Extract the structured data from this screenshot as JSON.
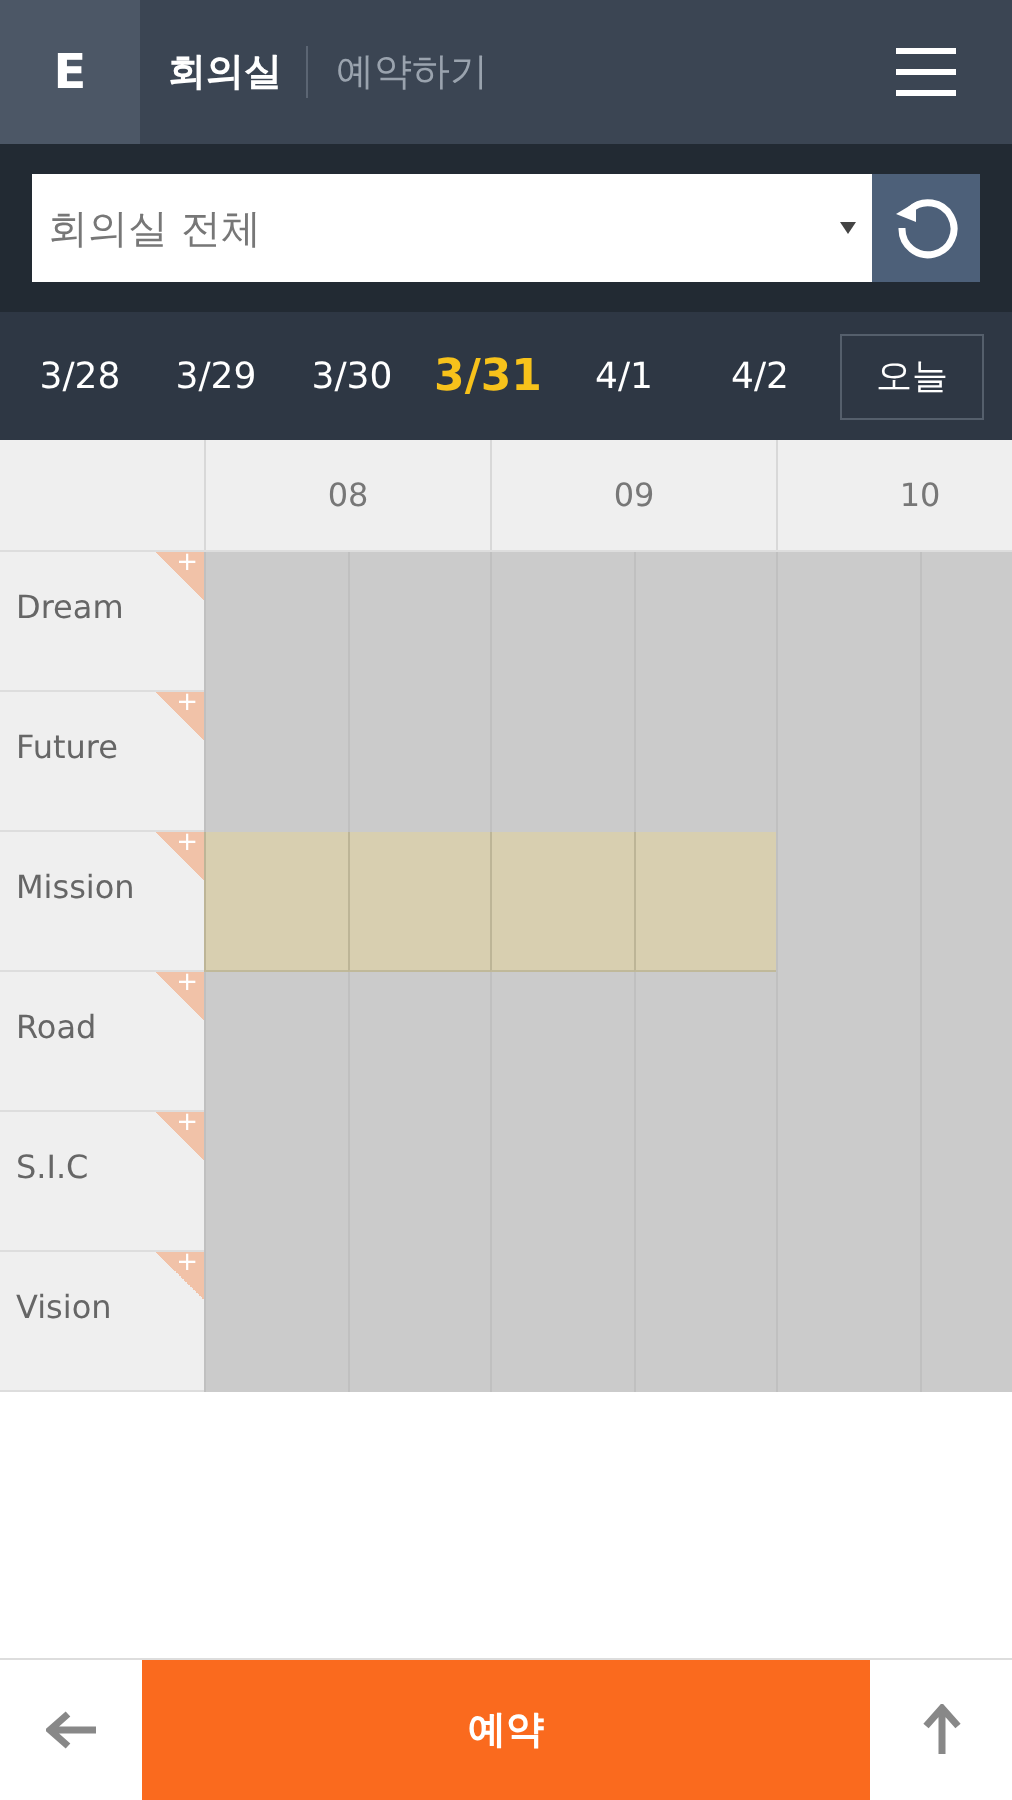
{
  "header": {
    "logo": "E",
    "title": "회의실",
    "subtitle": "예약하기"
  },
  "filter": {
    "value": "회의실 전체"
  },
  "dates": [
    {
      "label": "3/28",
      "selected": false
    },
    {
      "label": "3/29",
      "selected": false
    },
    {
      "label": "3/30",
      "selected": false
    },
    {
      "label": "3/31",
      "selected": true
    },
    {
      "label": "4/1",
      "selected": false
    },
    {
      "label": "4/2",
      "selected": false
    }
  ],
  "today_button": "오늘",
  "hours": [
    "08",
    "09",
    "10"
  ],
  "rooms": [
    {
      "name": "Dream",
      "add": "+",
      "slots": [
        false,
        false,
        false,
        false,
        false,
        false
      ]
    },
    {
      "name": "Future",
      "add": "+",
      "slots": [
        false,
        false,
        false,
        false,
        false,
        false
      ]
    },
    {
      "name": "Mission",
      "add": "+",
      "slots": [
        true,
        true,
        true,
        true,
        false,
        false
      ]
    },
    {
      "name": "Road",
      "add": "+",
      "slots": [
        false,
        false,
        false,
        false,
        false,
        false
      ]
    },
    {
      "name": "S.I.C",
      "add": "+",
      "slots": [
        false,
        false,
        false,
        false,
        false,
        false
      ]
    },
    {
      "name": "Vision",
      "add": "+",
      "slots": [
        false,
        false,
        false,
        false,
        false,
        false
      ]
    }
  ],
  "footer": {
    "button": "예약"
  }
}
